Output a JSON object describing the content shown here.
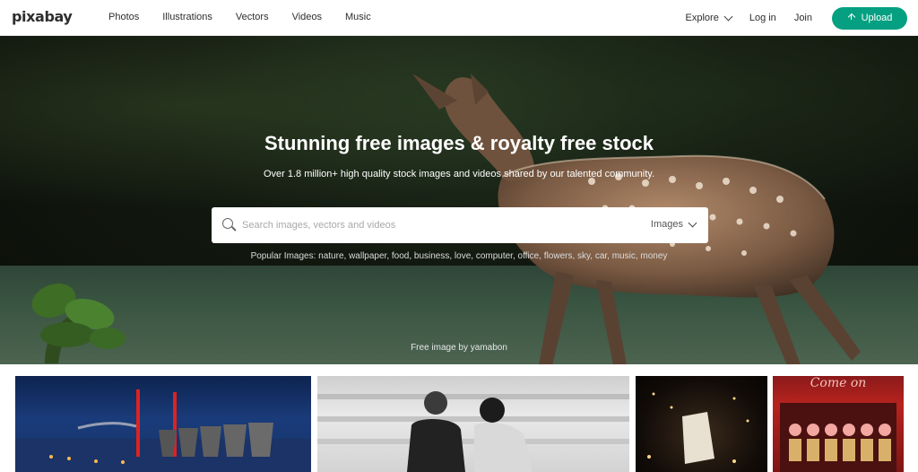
{
  "brand": {
    "logo": "pixabay",
    "accent": "#05a081"
  },
  "nav": {
    "items": [
      "Photos",
      "Illustrations",
      "Vectors",
      "Videos",
      "Music"
    ],
    "explore": "Explore",
    "login": "Log in",
    "join": "Join",
    "upload": "Upload"
  },
  "hero": {
    "title": "Stunning free images & royalty free stock",
    "subtitle": "Over 1.8 million+ high quality stock images and videos shared by our talented community.",
    "search_placeholder": "Search images, vectors and videos",
    "search_type": "Images",
    "popular": "Popular Images: nature, wallpaper, food, business, love, computer, office, flowers, sky, car, music, money",
    "credit": "Free image by yamabon"
  },
  "gallery": {
    "items": [
      {
        "name": "power-plant-night"
      },
      {
        "name": "couple-black-white"
      },
      {
        "name": "sky-lantern"
      },
      {
        "name": "food-stall"
      }
    ],
    "sign_text": "Come on"
  }
}
